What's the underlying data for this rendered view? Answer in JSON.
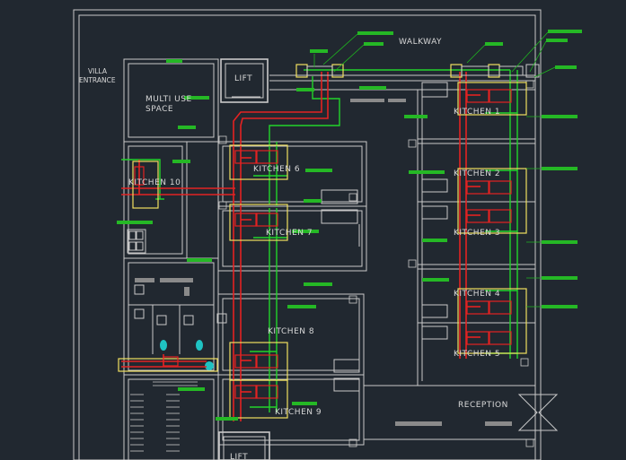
{
  "labels": {
    "walkway": "WALKWAY",
    "villa_entrance_1": "VILLA",
    "villa_entrance_2": "ENTRANCE",
    "lift_top": "LIFT",
    "lift_bottom": "LIFT",
    "multi_use_1": "MULTI USE",
    "multi_use_2": "SPACE",
    "kitchen_6": "KITCHEN 6",
    "kitchen_7": "KITCHEN 7",
    "kitchen_8": "KITCHEN 8",
    "kitchen_9": "KITCHEN 9",
    "kitchen_10": "KITCHEN 10",
    "kitchen_r1": "KITCHEN 1",
    "kitchen_r2": "KITCHEN 2",
    "kitchen_r3": "KITCHEN 3",
    "kitchen_r4": "KITCHEN 4",
    "kitchen_r5": "KITCHEN 5",
    "reception": "RECEPTION"
  },
  "colors": {
    "background": "#212830",
    "walls": "#c9c9c9",
    "exhaust_duct": "#e32222",
    "fresh_air_duct": "#22d42a",
    "hood": "#f0e060",
    "annotation": "#25b825"
  }
}
